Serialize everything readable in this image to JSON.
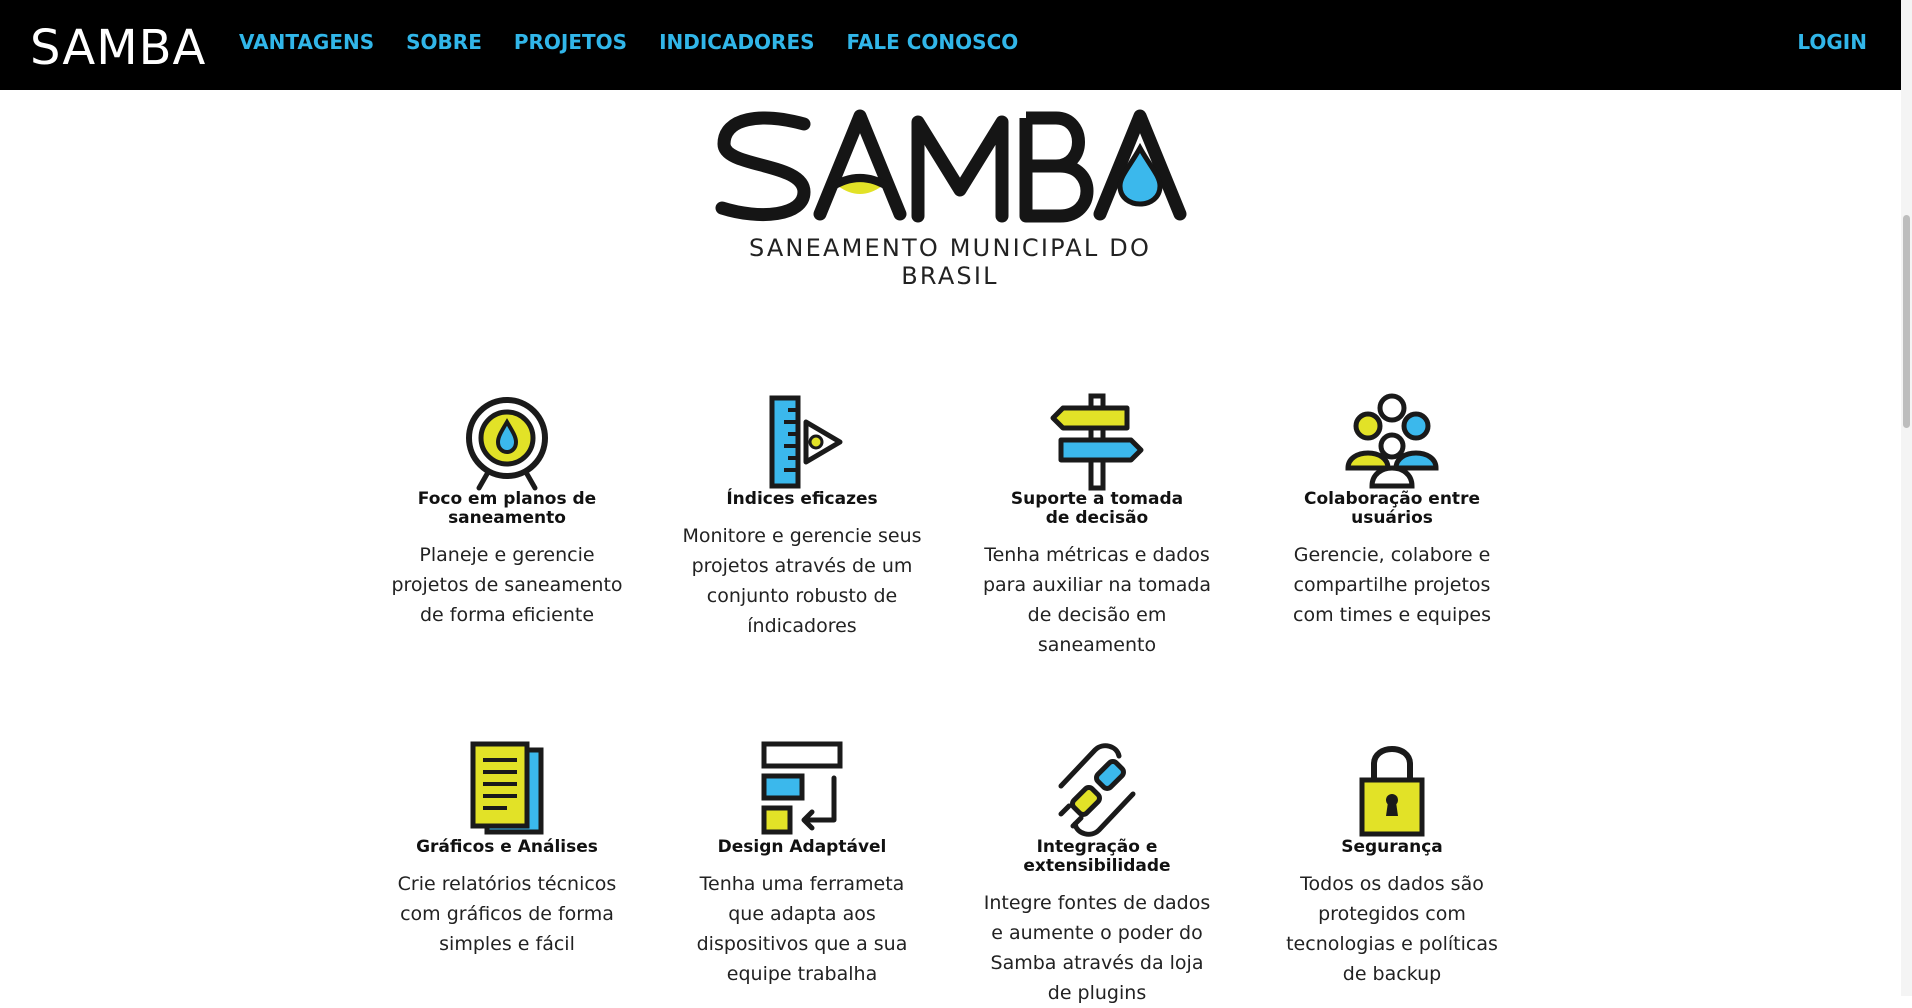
{
  "nav": {
    "brand": "SAMBA",
    "items": [
      "VANTAGENS",
      "SOBRE",
      "PROJETOS",
      "INDICADORES",
      "FALE CONOSCO"
    ],
    "login": "LOGIN"
  },
  "hero": {
    "logo_text": "SAMBA",
    "subtitle": "SANEAMENTO MUNICIPAL DO BRASIL"
  },
  "colors": {
    "yellow": "#e2e227",
    "blue": "#3bb8ec",
    "nav_bg": "#000000",
    "nav_link": "#31b6e9"
  },
  "features": [
    {
      "icon": "target-drop-icon",
      "title": "Foco em planos de saneamento",
      "desc": "Planeje e gerencie projetos de saneamento de forma eficiente"
    },
    {
      "icon": "ruler-eye-icon",
      "title": "Índices eficazes",
      "desc": "Monitore e gerencie seus projetos através de um conjunto robusto de índicadores"
    },
    {
      "icon": "signpost-icon",
      "title": "Suporte a tomada de decisão",
      "desc": "Tenha métricas e dados para auxiliar na tomada de decisão em saneamento"
    },
    {
      "icon": "users-group-icon",
      "title": "Colaboração entre usuários",
      "desc": "Gerencie, colabore e compartilhe projetos com times e equipes"
    },
    {
      "icon": "documents-icon",
      "title": "Gráficos e Análises",
      "desc": "Crie relatórios técnicos com gráficos de forma simples e fácil"
    },
    {
      "icon": "adaptive-layout-icon",
      "title": "Design Adaptável",
      "desc": "Tenha uma ferrameta que adapta aos dispositivos que a sua equipe trabalha"
    },
    {
      "icon": "plug-icon",
      "title": "Integração e extensibilidade",
      "desc": "Integre fontes de dados e aumente o poder do Samba através da loja de plugins"
    },
    {
      "icon": "padlock-icon",
      "title": "Segurança",
      "desc": "Todos os dados são protegidos com tecnologias e políticas de backup"
    }
  ]
}
